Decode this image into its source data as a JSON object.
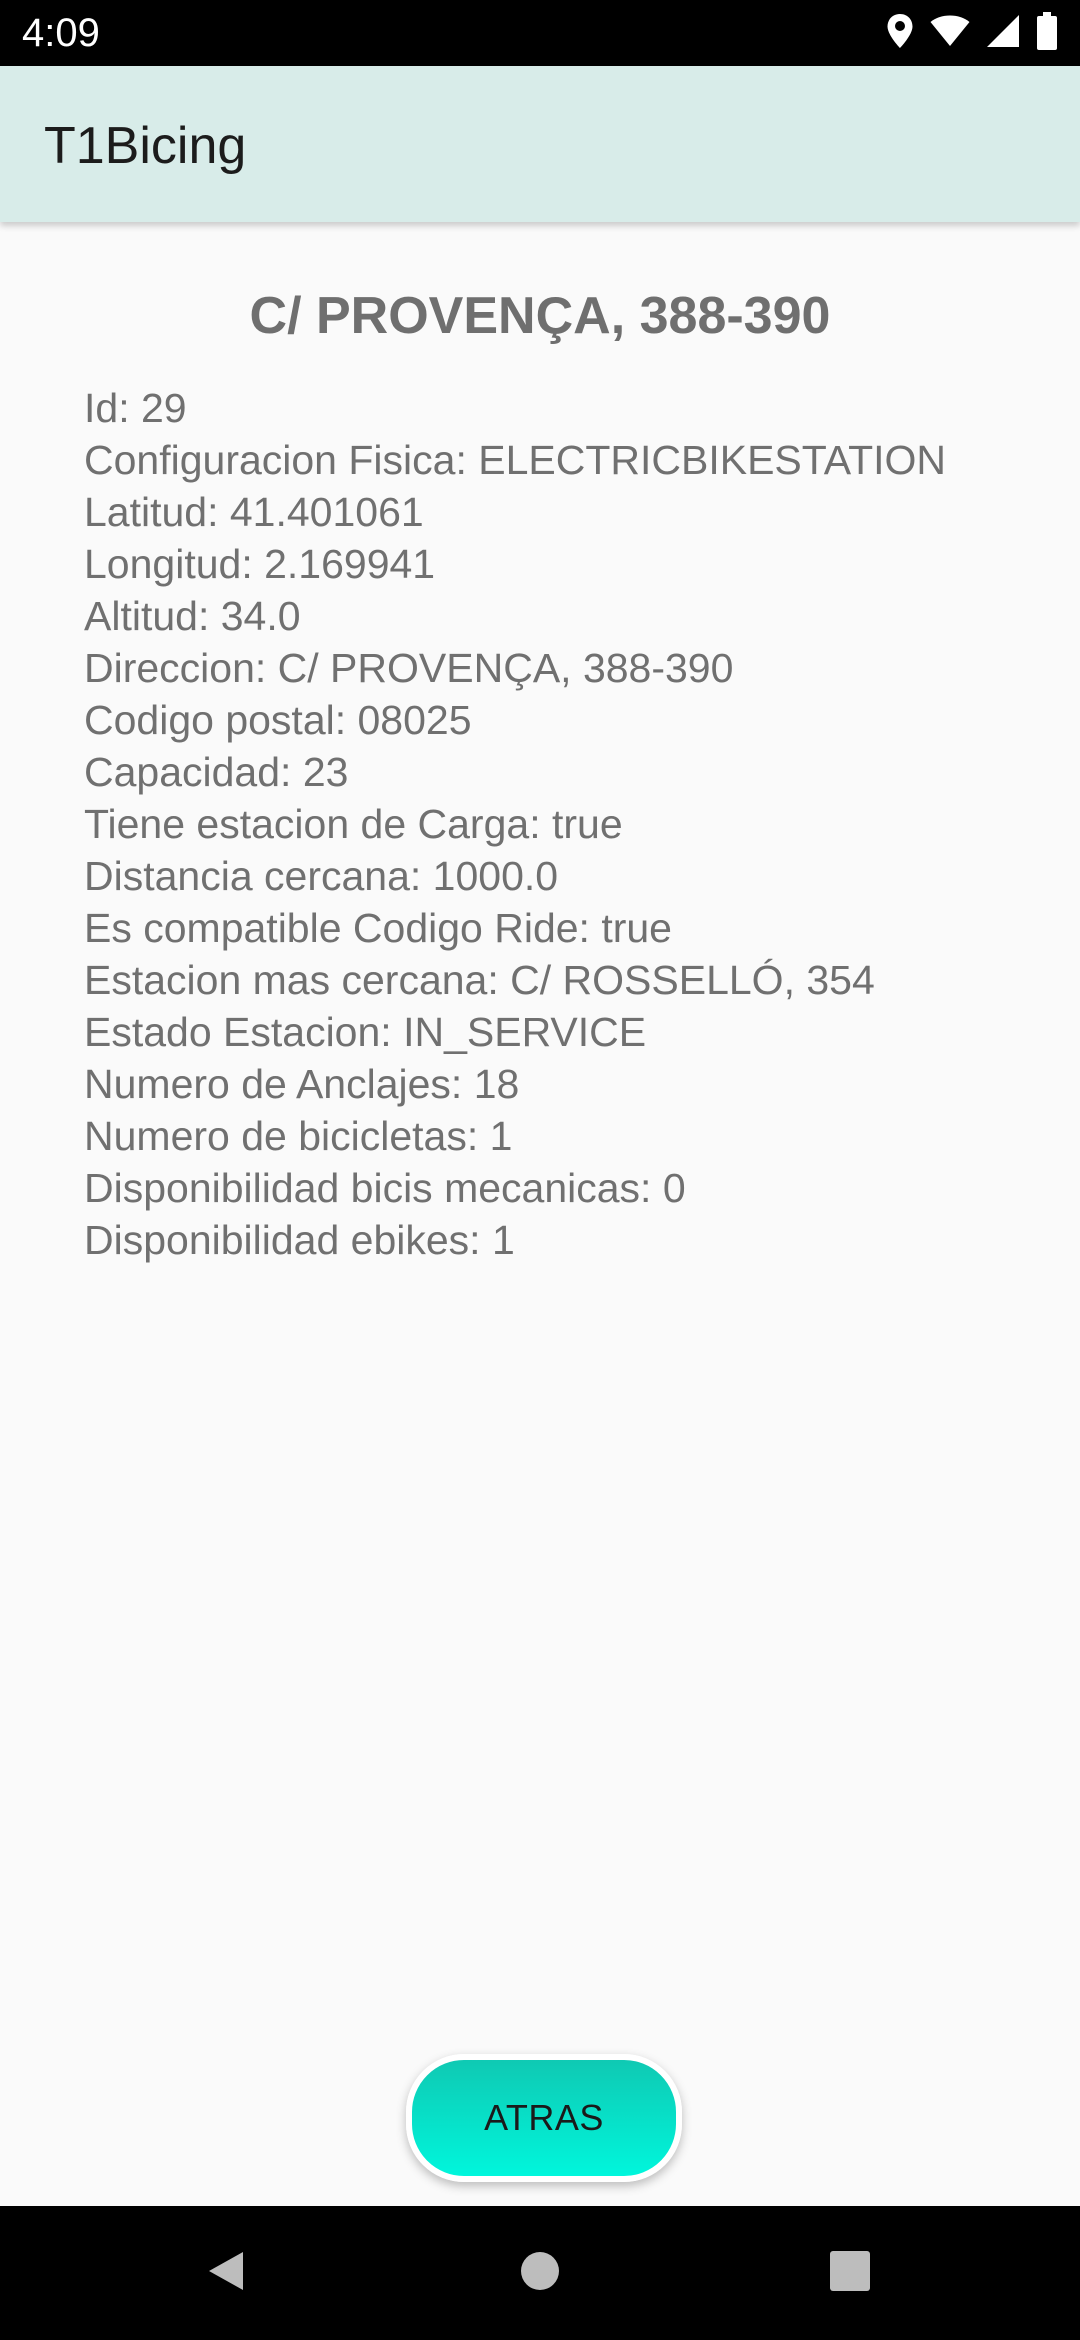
{
  "status_bar": {
    "time": "4:09",
    "icons": [
      "location-icon",
      "wifi-icon",
      "signal-icon",
      "battery-icon"
    ]
  },
  "app_bar": {
    "title": "T1Bicing"
  },
  "station": {
    "title": "C/ PROVENÇA, 388-390",
    "details": [
      "Id: 29",
      "Configuracion Fisica: ELECTRICBIKESTATION",
      "Latitud: 41.401061",
      "Longitud: 2.169941",
      "Altitud: 34.0",
      "Direccion: C/ PROVENÇA, 388-390",
      "Codigo postal: 08025",
      "Capacidad: 23",
      "Tiene estacion de Carga: true",
      "Distancia cercana: 1000.0",
      "Es compatible Codigo Ride: true",
      "Estacion mas cercana: C/ ROSSELLÓ, 354",
      "Estado Estacion: IN_SERVICE",
      "Numero de Anclajes: 18",
      "Numero de bicicletas: 1",
      "Disponibilidad bicis mecanicas: 0",
      "Disponibilidad ebikes: 1"
    ]
  },
  "back_button": {
    "label": "ATRAS"
  },
  "nav_bar": {
    "icons": [
      "back-icon",
      "home-icon",
      "recents-icon"
    ]
  },
  "colors": {
    "app_bar_bg": "#d8ece9",
    "button_accent": "#00f6dc",
    "text_gray": "#707070"
  }
}
